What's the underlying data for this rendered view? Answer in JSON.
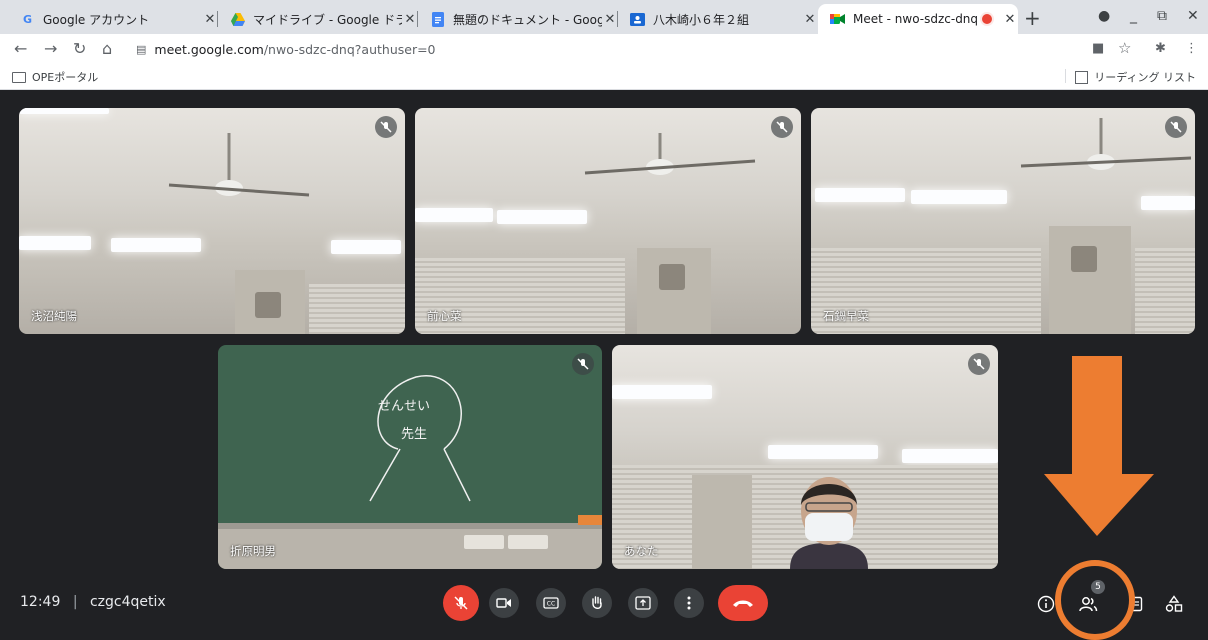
{
  "browser": {
    "tabs": [
      {
        "title": "Google アカウント",
        "icon": "google-g-icon"
      },
      {
        "title": "マイドライブ - Google ドラ",
        "icon": "drive-icon"
      },
      {
        "title": "無題のドキュメント - Googl",
        "icon": "docs-icon"
      },
      {
        "title": "八木崎小６年２組",
        "icon": "classroom-icon"
      },
      {
        "title": "Meet - nwo-sdzc-dnq",
        "icon": "meet-icon",
        "active": true
      }
    ],
    "url_host": "meet.google.com",
    "url_path": "/nwo-sdzc-dnq?authuser=0",
    "bookmark_folder": "OPEポータル",
    "reading_list": "リーディング リスト"
  },
  "participants": [
    {
      "name": "浅沼純陽"
    },
    {
      "name": "前心菜"
    },
    {
      "name": "石鍋早菜"
    },
    {
      "name": "折原明男"
    },
    {
      "name": "あなた"
    }
  ],
  "blackboard": {
    "line1": "せんせい",
    "line2": "先生"
  },
  "meeting": {
    "time": "12:49",
    "code": "czgc4qetix",
    "participant_count": "5"
  },
  "colors": {
    "accent_orange": "#ed7d31",
    "end_call_red": "#ea4335",
    "meet_dark": "#202124"
  }
}
